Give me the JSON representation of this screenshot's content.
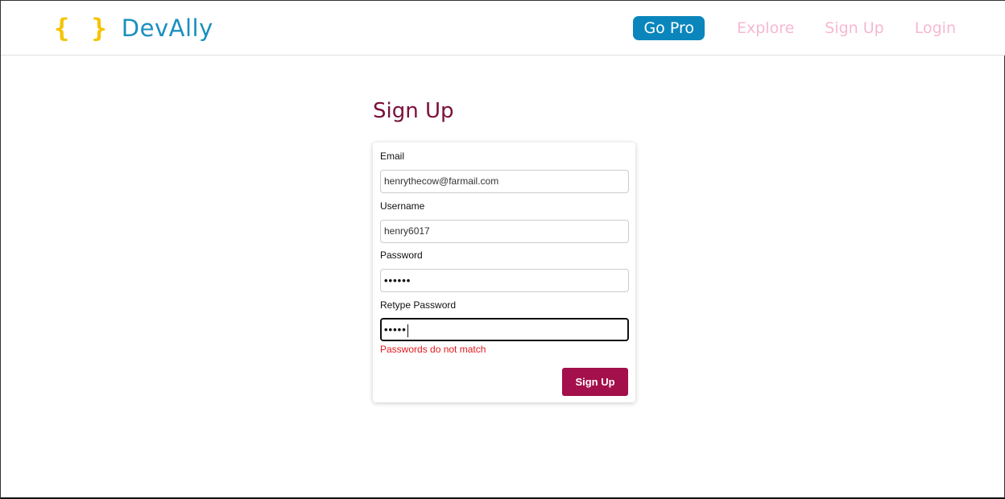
{
  "brand": {
    "braces": "{ }",
    "name": "DevAlly"
  },
  "nav": {
    "go_pro": "Go Pro",
    "explore": "Explore",
    "signup": "Sign Up",
    "login": "Login"
  },
  "page": {
    "title": "Sign Up"
  },
  "form": {
    "email_label": "Email",
    "email_value": "henrythecow@farmail.com",
    "username_label": "Username",
    "username_value": "henry6017",
    "password_label": "Password",
    "password_mask": "••••••",
    "retype_label": "Retype Password",
    "retype_mask": "•••••",
    "error": "Passwords do not match",
    "submit": "Sign Up"
  },
  "colors": {
    "brand_braces": "#f5c400",
    "brand_name": "#1a8fbf",
    "go_pro_bg": "#0a86bc",
    "nav_link": "#f6b8d2",
    "title": "#7a0f3a",
    "submit_bg": "#a3104b",
    "error": "#e0191d"
  }
}
